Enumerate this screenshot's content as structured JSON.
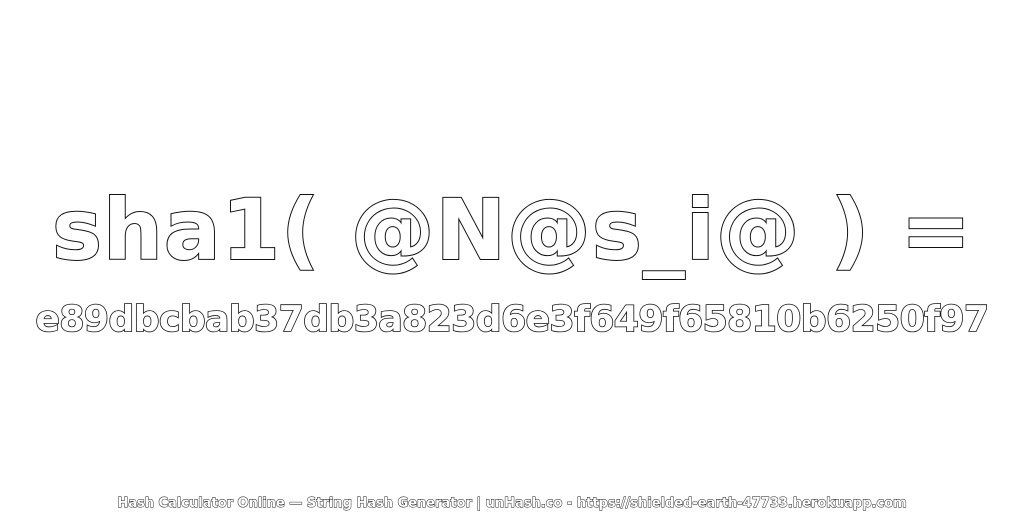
{
  "expression": "sha1( @N@s_i@ ) =",
  "hash": "e89dbcbab37db3a823d6e3f649f65810b6250f97",
  "footer": "Hash Calculator Online — String Hash Generator | unHash.co - https://shielded-earth-47733.herokuapp.com"
}
